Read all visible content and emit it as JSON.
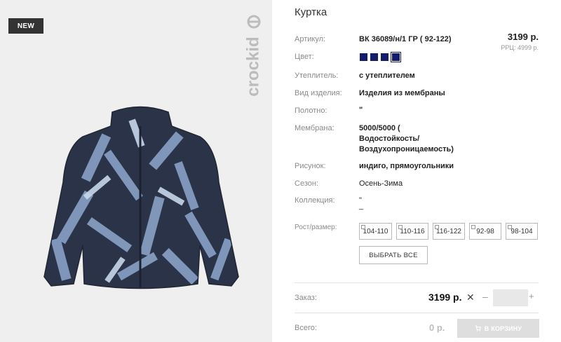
{
  "badge": "NEW",
  "brand": "crockid",
  "title": "Куртка",
  "price": "3199 р.",
  "rrp": "РРЦ: 4999 р.",
  "swatch_color": "#141d6b",
  "details": {
    "article_label": "Артикул:",
    "article_value": "ВК 36089/н/1 ГР ( 92-122)",
    "color_label": "Цвет:",
    "insulation_label": "Утеплитель:",
    "insulation_value": "с утеплителем",
    "type_label": "Вид изделия:",
    "type_value": "Изделия из мембраны",
    "fabric_label": "Полотно:",
    "fabric_value": "\"",
    "membrane_label": "Мембрана:",
    "membrane_value_1": "5000/5000 (",
    "membrane_value_2": "Водостойкость/",
    "membrane_value_3": "Воздухопроницаемость)",
    "pattern_label": "Рисунок:",
    "pattern_value": "индиго, прямоугольники",
    "season_label": "Сезон:",
    "season_value": "Осень-Зима",
    "collection_label": "Коллекция:",
    "collection_value_1": "\"",
    "collection_value_2": "_"
  },
  "sizes_label": "Рост/размер:",
  "sizes": [
    "104-110",
    "110-116",
    "116-122",
    "92-98",
    "98-104"
  ],
  "select_all": "ВЫБРАТЬ ВСЕ",
  "order": {
    "label": "Заказ:",
    "price": "3199 р.",
    "remove": "✕",
    "minus": "–",
    "plus": "+",
    "qty": ""
  },
  "total": {
    "label": "Всего:",
    "value": "0 р."
  },
  "cart_button": "В КОРЗИНУ"
}
